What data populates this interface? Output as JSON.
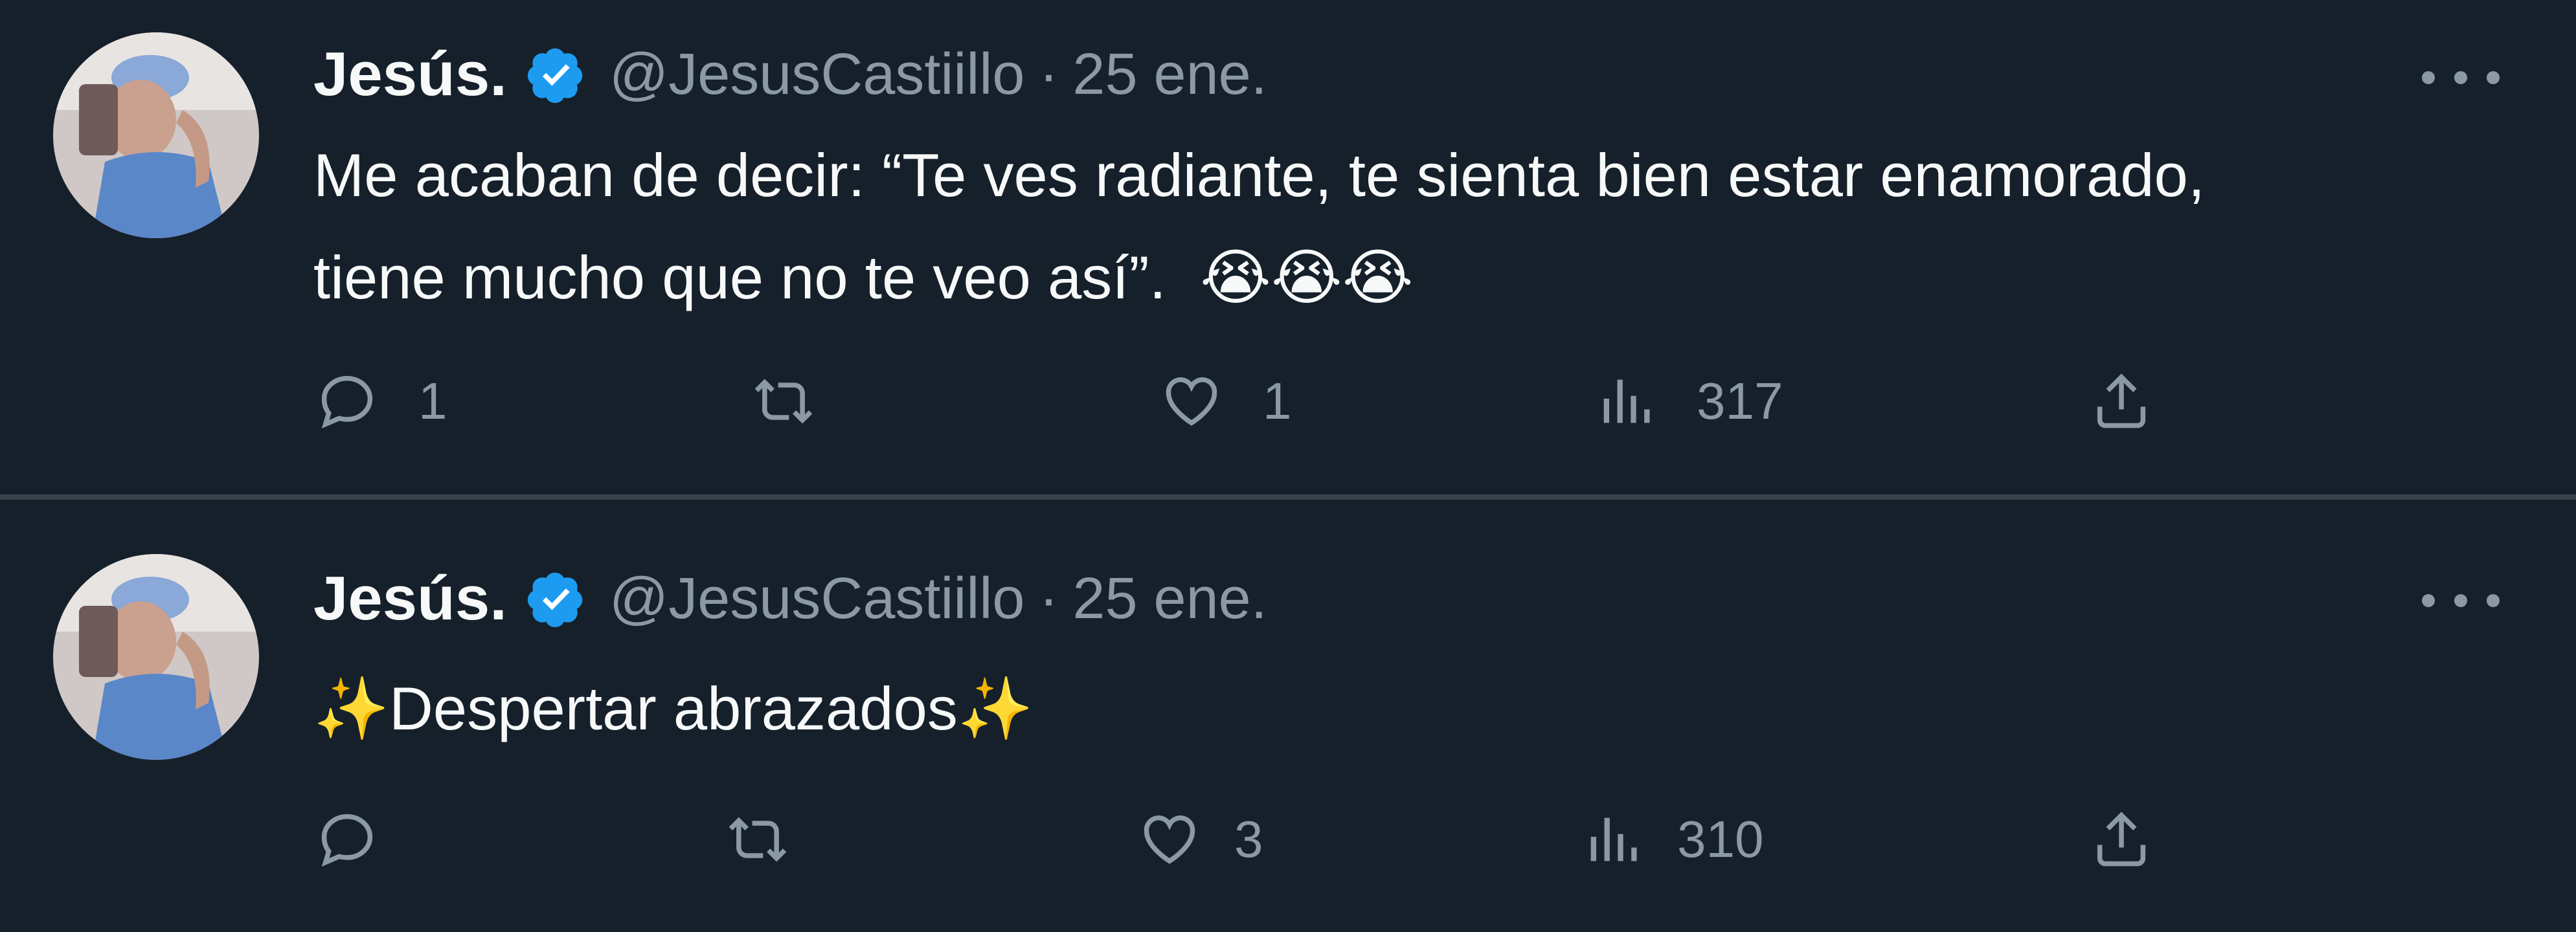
{
  "tweets": [
    {
      "author_name": "Jesús.",
      "handle": "@JesusCastiillo",
      "separator": "·",
      "date": "25 ene.",
      "text": "Me acaban de decir: “Te ves radiante, te sienta bien estar enamorado,\ntiene mucho que no te veo así”.",
      "text_emoji": "😭😭😭",
      "replies": "1",
      "retweets": "",
      "likes": "1",
      "views": "317",
      "icons": {
        "verified": "verified-badge-icon",
        "more": "more-options-icon",
        "reply": "reply-icon",
        "retweet": "retweet-icon",
        "like": "heart-icon",
        "views": "views-chart-icon",
        "share": "share-icon"
      }
    },
    {
      "author_name": "Jesús.",
      "handle": "@JesusCastiillo",
      "separator": "·",
      "date": "25 ene.",
      "text_prefix_emoji": "✨",
      "text": "Despertar abrazados",
      "text_suffix_emoji": "✨",
      "replies": "",
      "retweets": "",
      "likes": "3",
      "views": "310"
    }
  ],
  "colors": {
    "background": "#15202b",
    "divider": "#38444d",
    "primary_text": "#f7f9f9",
    "secondary_text": "#8b98a5",
    "verified_blue": "#1d9bf0"
  }
}
